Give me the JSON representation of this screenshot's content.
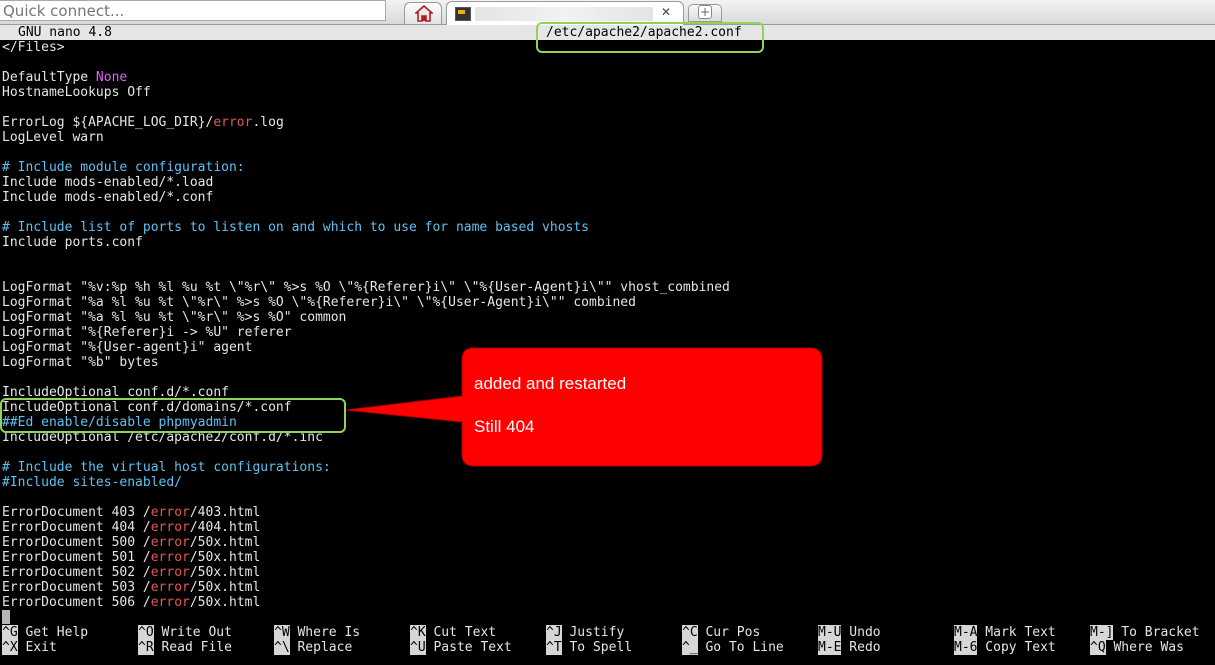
{
  "browser": {
    "quick_connect_placeholder": "Quick connect...",
    "icons": [
      "home-icon",
      "key-icon",
      "close-icon",
      "new-tab-icon"
    ],
    "tab_close_glyph": "✕",
    "new_tab_glyph": "+"
  },
  "editor": {
    "app_name": "GNU nano 4.8",
    "file_path": "/etc/apache2/apache2.conf",
    "lines": [
      [
        {
          "t": "</Files>"
        }
      ],
      [
        {
          "t": ""
        }
      ],
      [
        {
          "t": "DefaultType "
        },
        {
          "t": "None",
          "s": "m"
        }
      ],
      [
        {
          "t": "HostnameLookups Off"
        }
      ],
      [
        {
          "t": ""
        }
      ],
      [
        {
          "t": "ErrorLog ${APACHE_LOG_DIR}/"
        },
        {
          "t": "error",
          "s": "r"
        },
        {
          "t": ".log"
        }
      ],
      [
        {
          "t": "LogLevel warn"
        }
      ],
      [
        {
          "t": ""
        }
      ],
      [
        {
          "t": "# Include module configuration:",
          "s": "c"
        }
      ],
      [
        {
          "t": "Include mods-enabled/*.load"
        }
      ],
      [
        {
          "t": "Include mods-enabled/*.conf"
        }
      ],
      [
        {
          "t": ""
        }
      ],
      [
        {
          "t": "# Include list of ports to listen on and which to use for name based vhosts",
          "s": "c"
        }
      ],
      [
        {
          "t": "Include ports.conf"
        }
      ],
      [
        {
          "t": ""
        }
      ],
      [
        {
          "t": ""
        }
      ],
      [
        {
          "t": "LogFormat \"%v:%p %h %l %u %t \\\"%r\\\" %>s %O \\\"%{Referer}i\\\" \\\"%{User-Agent}i\\\"\" vhost_combined"
        }
      ],
      [
        {
          "t": "LogFormat \"%a %l %u %t \\\"%r\\\" %>s %O \\\"%{Referer}i\\\" \\\"%{User-Agent}i\\\"\" combined"
        }
      ],
      [
        {
          "t": "LogFormat \"%a %l %u %t \\\"%r\\\" %>s %O\" common"
        }
      ],
      [
        {
          "t": "LogFormat \"%{Referer}i -> %U\" referer"
        }
      ],
      [
        {
          "t": "LogFormat \"%{User-agent}i\" agent"
        }
      ],
      [
        {
          "t": "LogFormat \"%b\" bytes"
        }
      ],
      [
        {
          "t": ""
        }
      ],
      [
        {
          "t": "IncludeOptional conf.d/*.conf"
        }
      ],
      [
        {
          "t": "IncludeOptional conf.d/domains/*.conf"
        }
      ],
      [
        {
          "t": "##Ed enable/disable phpmyadmin",
          "s": "c"
        }
      ],
      [
        {
          "t": "IncludeOptional /etc/apache2/conf.d/*.inc"
        }
      ],
      [
        {
          "t": ""
        }
      ],
      [
        {
          "t": "# Include the virtual host configurations:",
          "s": "c"
        }
      ],
      [
        {
          "t": "#Include sites-enabled/",
          "s": "c"
        }
      ],
      [
        {
          "t": ""
        }
      ],
      [
        {
          "t": "ErrorDocument 403 /"
        },
        {
          "t": "error",
          "s": "r"
        },
        {
          "t": "/403.html"
        }
      ],
      [
        {
          "t": "ErrorDocument 404 /"
        },
        {
          "t": "error",
          "s": "r"
        },
        {
          "t": "/404.html"
        }
      ],
      [
        {
          "t": "ErrorDocument 500 /"
        },
        {
          "t": "error",
          "s": "r"
        },
        {
          "t": "/50x.html"
        }
      ],
      [
        {
          "t": "ErrorDocument 501 /"
        },
        {
          "t": "error",
          "s": "r"
        },
        {
          "t": "/50x.html"
        }
      ],
      [
        {
          "t": "ErrorDocument 502 /"
        },
        {
          "t": "error",
          "s": "r"
        },
        {
          "t": "/50x.html"
        }
      ],
      [
        {
          "t": "ErrorDocument 503 /"
        },
        {
          "t": "error",
          "s": "r"
        },
        {
          "t": "/50x.html"
        }
      ],
      [
        {
          "t": "ErrorDocument 506 /"
        },
        {
          "t": "error",
          "s": "r"
        },
        {
          "t": "/50x.html"
        }
      ],
      [
        {
          "t": "",
          "cursor": true
        }
      ]
    ],
    "shortcuts_row1": [
      {
        "key": "^G",
        "label": "Get Help"
      },
      {
        "key": "^O",
        "label": "Write Out"
      },
      {
        "key": "^W",
        "label": "Where Is"
      },
      {
        "key": "^K",
        "label": "Cut Text"
      },
      {
        "key": "^J",
        "label": "Justify"
      },
      {
        "key": "^C",
        "label": "Cur Pos"
      },
      {
        "key": "M-U",
        "label": "Undo"
      },
      {
        "key": "M-A",
        "label": "Mark Text"
      },
      {
        "key": "M-]",
        "label": "To Bracket"
      }
    ],
    "shortcuts_row2": [
      {
        "key": "^X",
        "label": "Exit"
      },
      {
        "key": "^R",
        "label": "Read File"
      },
      {
        "key": "^\\",
        "label": "Replace"
      },
      {
        "key": "^U",
        "label": "Paste Text"
      },
      {
        "key": "^T",
        "label": "To Spell"
      },
      {
        "key": "^_",
        "label": "Go To Line"
      },
      {
        "key": "M-E",
        "label": "Redo"
      },
      {
        "key": "M-6",
        "label": "Copy Text"
      },
      {
        "key": "^Q",
        "label": "Where Was"
      }
    ]
  },
  "annotation": {
    "line1": "added and restarted",
    "line2": "Still 404",
    "callout_color": "#fe0000",
    "highlight_color": "#8ed35a"
  },
  "colors": {
    "comment": "#5fc1f3",
    "keyword": "#e25ef5",
    "error": "#e35656"
  }
}
